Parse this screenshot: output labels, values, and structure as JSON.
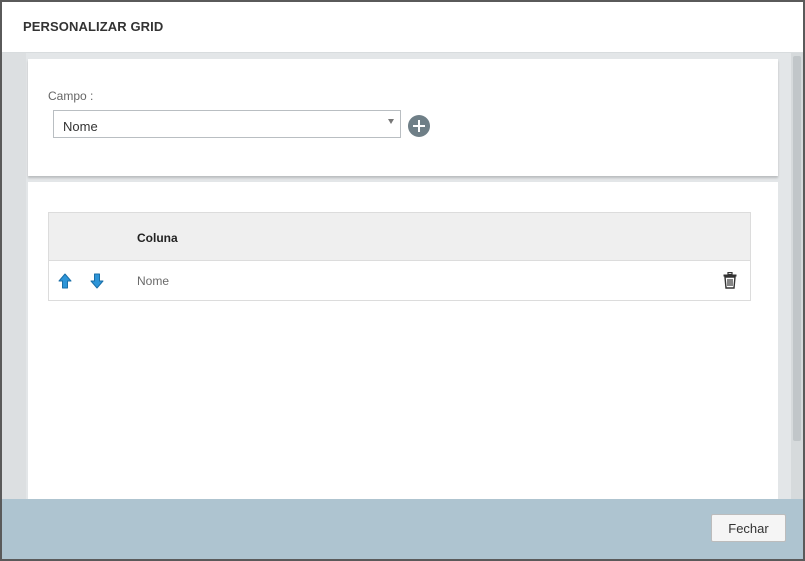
{
  "modal": {
    "title": "PERSONALIZAR GRID"
  },
  "field_panel": {
    "label": "Campo :",
    "selected_value": "Nome",
    "add_icon": "plus-circle-icon"
  },
  "grid": {
    "column_header": "Coluna",
    "rows": [
      {
        "value": "Nome",
        "up_icon": "arrow-up-icon",
        "down_icon": "arrow-down-icon",
        "delete_icon": "trash-icon"
      }
    ]
  },
  "footer": {
    "close_label": "Fechar"
  },
  "colors": {
    "footer_bg": "#aec4d0",
    "arrow_blue": "#2d95d8",
    "add_button": "#6f7f87"
  }
}
